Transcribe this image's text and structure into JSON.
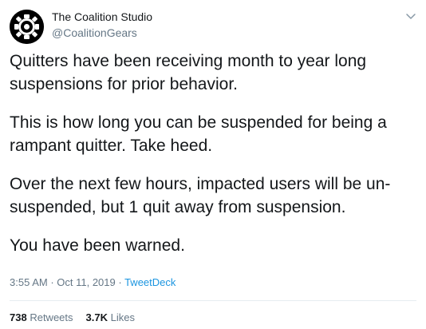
{
  "author": {
    "name": "The Coalition Studio",
    "handle": "@CoalitionGears",
    "avatar_icon": "coalition-gear-logo-icon"
  },
  "tweet": {
    "paragraphs": [
      [
        "Quitters have been receiving month to year long",
        "suspensions for prior behavior."
      ],
      [
        "This is how long you can be suspended for being a",
        "rampant quitter. Take heed."
      ],
      [
        "Over the next few hours, impacted users will be un-",
        "suspended, but 1 quit away from suspension."
      ],
      [
        "You have been warned."
      ]
    ]
  },
  "meta": {
    "time": "3:55 AM",
    "separator": " · ",
    "date": "Oct 11, 2019",
    "separator2": " · ",
    "source": "TweetDeck"
  },
  "stats": {
    "retweets_count": "738",
    "retweets_label": "Retweets",
    "likes_count": "3.7K",
    "likes_label": "Likes"
  },
  "icons": {
    "menu": "chevron-down-icon"
  },
  "colors": {
    "text": "#14171a",
    "secondary": "#657786",
    "link": "#1b95e0",
    "divider": "#e6ecf0"
  }
}
